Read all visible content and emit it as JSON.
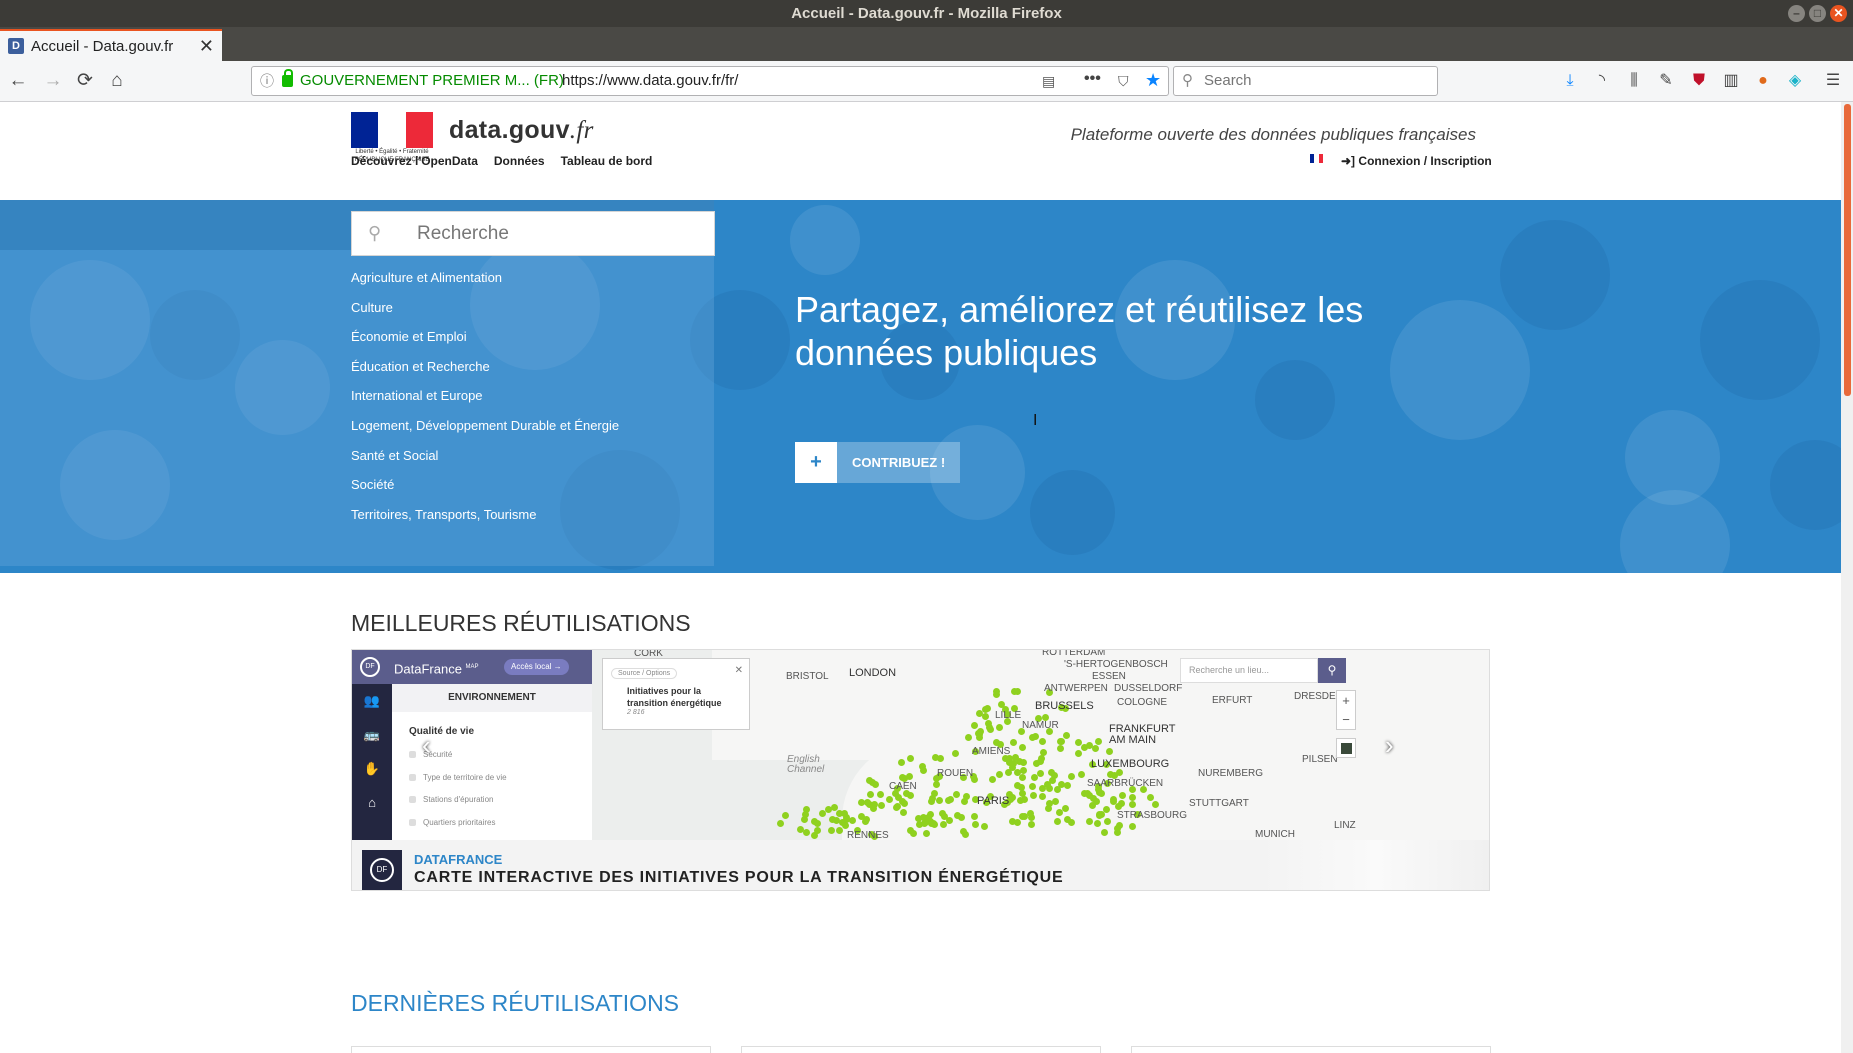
{
  "window": {
    "title": "Accueil - Data.gouv.fr - Mozilla Firefox"
  },
  "tab": {
    "favicon": "D",
    "title": "Accueil - Data.gouv.fr",
    "close": "✕",
    "new_tab": "+"
  },
  "navbar": {
    "back": "←",
    "forward": "→",
    "reload": "⟳",
    "home": "⌂",
    "identity": "GOUVERNEMENT PREMIER M... (FR)",
    "url": "https://www.data.gouv.fr/fr/",
    "page_actions": "•••",
    "search_placeholder": "Search"
  },
  "site": {
    "logo_caption": "Liberté • Égalité • Fraternité RÉPUBLIQUE FRANÇAISE",
    "brand": "data.gouv",
    "brand_suffix": ".fr",
    "tagline": "Plateforme ouverte des données publiques françaises",
    "nav": [
      "Découvrez l'OpenData",
      "Données",
      "Tableau de bord"
    ],
    "login": "Connexion / Inscription"
  },
  "hero": {
    "search_placeholder": "Recherche",
    "topics": [
      "Agriculture et Alimentation",
      "Culture",
      "Économie et Emploi",
      "Éducation et Recherche",
      "International et Europe",
      "Logement, Développement Durable et Énergie",
      "Santé et Social",
      "Société",
      "Territoires, Transports, Tourisme"
    ],
    "title": "Partagez, améliorez et réutilisez les données publiques",
    "contrib_plus": "+",
    "contrib_label": "CONTRIBUEZ !"
  },
  "best": {
    "title": "MEILLEURES RÉUTILISATIONS",
    "shot": {
      "app_name": "DataFrance",
      "app_sup": "MAP",
      "acces": "Accès local →",
      "section": "ENVIRONNEMENT",
      "group": "Qualité de vie",
      "items": [
        "Sécurité",
        "Type de territoire de vie",
        "Stations d'épuration",
        "Quartiers prioritaires"
      ],
      "popup_options": "Source / Options",
      "popup_title": "Initiatives pour la transition énergétique",
      "popup_count": "2 816",
      "map_search": "Recherche un lieu...",
      "cities": [
        "CORK",
        "ROTTERDAM",
        "'S-HERTOGENBOSCH",
        "BRISTOL",
        "LONDON",
        "ESSEN",
        "ANTWERPEN",
        "DUSSELDORF",
        "ERFURT",
        "DRESDEN",
        "BRUSSELS",
        "COLOGNE",
        "FRANKFURT AM MAIN",
        "LUXEMBOURG",
        "NAMUR",
        "NUREMBERG",
        "PILSEN",
        "STUTTGART",
        "PARIS",
        "CAEN",
        "AMIENS",
        "STRASBOURG",
        "SAARBRÜCKEN",
        "MUNICH",
        "LINZ",
        "RENNES",
        "LILLE",
        "ROUEN",
        "English Channel"
      ]
    },
    "org": "DATAFRANCE",
    "caption": "CARTE INTERACTIVE DES INITIATIVES POUR LA TRANSITION ÉNERGÉTIQUE"
  },
  "latest": {
    "title": "DERNIÈRES RÉUTILISATIONS"
  },
  "colors": {
    "hero_blue": "#2d86c8",
    "accent": "#e95420",
    "map_dots": "#8fd11f"
  }
}
